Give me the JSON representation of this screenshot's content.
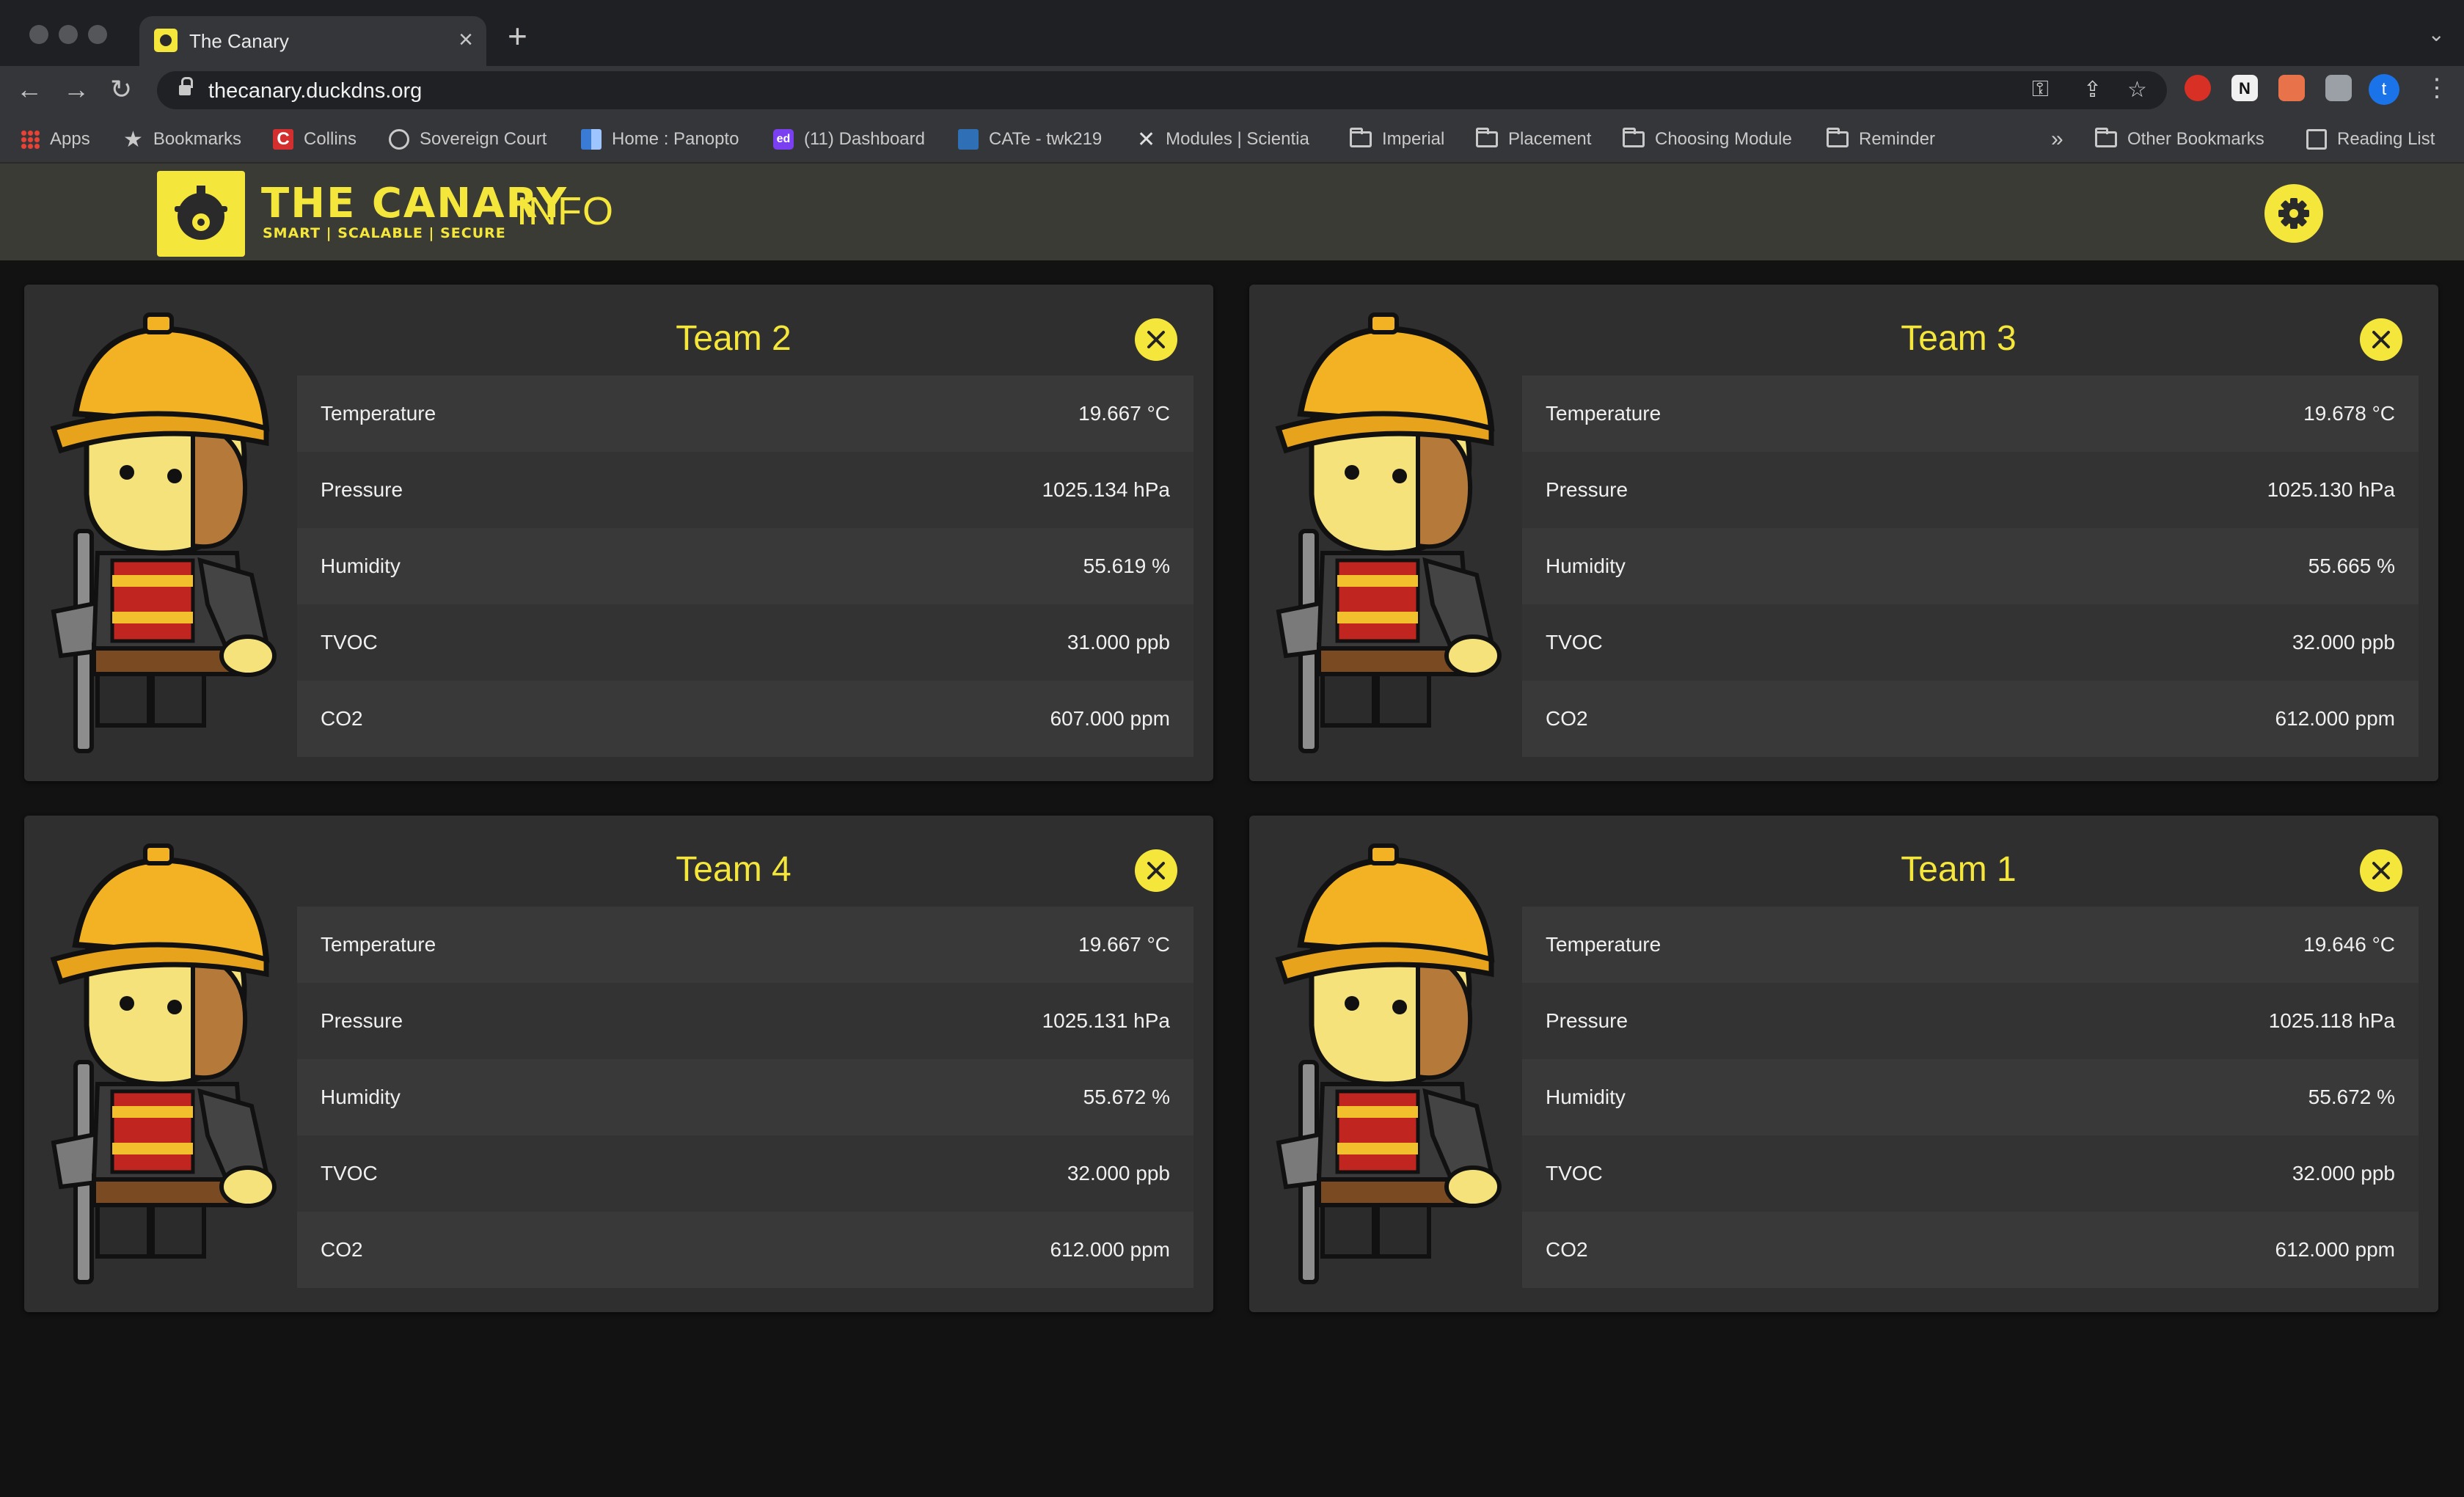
{
  "browser": {
    "tab_title": "The Canary",
    "url": "thecanary.duckdns.org",
    "profile_initial": "t",
    "bookmarks": [
      {
        "label": "Apps",
        "icon": "apps-grid-icon"
      },
      {
        "label": "Bookmarks",
        "icon": "star-icon"
      },
      {
        "label": "Collins",
        "icon": "collins-icon"
      },
      {
        "label": "Sovereign Court",
        "icon": "globe-icon"
      },
      {
        "label": "Home : Panopto",
        "icon": "panopto-icon"
      },
      {
        "label": "(11) Dashboard",
        "icon": "ed-icon"
      },
      {
        "label": "CATe - twk219",
        "icon": "cate-icon"
      },
      {
        "label": "Modules | Scientia",
        "icon": "scientia-icon"
      },
      {
        "label": "Imperial",
        "icon": "folder-icon"
      },
      {
        "label": "Placement",
        "icon": "folder-icon"
      },
      {
        "label": "Choosing Module",
        "icon": "folder-icon"
      },
      {
        "label": "Reminder",
        "icon": "folder-icon"
      }
    ],
    "overflow_label": "»",
    "other_bookmarks": "Other Bookmarks",
    "reading_list": "Reading List"
  },
  "app": {
    "logo_title": "THE CANARY",
    "logo_subtitle": "SMART | SCALABLE | SECURE",
    "page_title": "INFO",
    "accent_color": "#f5e63b"
  },
  "cards": [
    {
      "team": "Team 2",
      "readings": [
        {
          "label": "Temperature",
          "value": "19.667 °C"
        },
        {
          "label": "Pressure",
          "value": "1025.134 hPa"
        },
        {
          "label": "Humidity",
          "value": "55.619 %"
        },
        {
          "label": "TVOC",
          "value": "31.000 ppb"
        },
        {
          "label": "CO2",
          "value": "607.000 ppm"
        }
      ]
    },
    {
      "team": "Team 3",
      "readings": [
        {
          "label": "Temperature",
          "value": "19.678 °C"
        },
        {
          "label": "Pressure",
          "value": "1025.130 hPa"
        },
        {
          "label": "Humidity",
          "value": "55.665 %"
        },
        {
          "label": "TVOC",
          "value": "32.000 ppb"
        },
        {
          "label": "CO2",
          "value": "612.000 ppm"
        }
      ]
    },
    {
      "team": "Team 4",
      "readings": [
        {
          "label": "Temperature",
          "value": "19.667 °C"
        },
        {
          "label": "Pressure",
          "value": "1025.131 hPa"
        },
        {
          "label": "Humidity",
          "value": "55.672 %"
        },
        {
          "label": "TVOC",
          "value": "32.000 ppb"
        },
        {
          "label": "CO2",
          "value": "612.000 ppm"
        }
      ]
    },
    {
      "team": "Team 1",
      "readings": [
        {
          "label": "Temperature",
          "value": "19.646 °C"
        },
        {
          "label": "Pressure",
          "value": "1025.118 hPa"
        },
        {
          "label": "Humidity",
          "value": "55.672 %"
        },
        {
          "label": "TVOC",
          "value": "32.000 ppb"
        },
        {
          "label": "CO2",
          "value": "612.000 ppm"
        }
      ]
    }
  ]
}
